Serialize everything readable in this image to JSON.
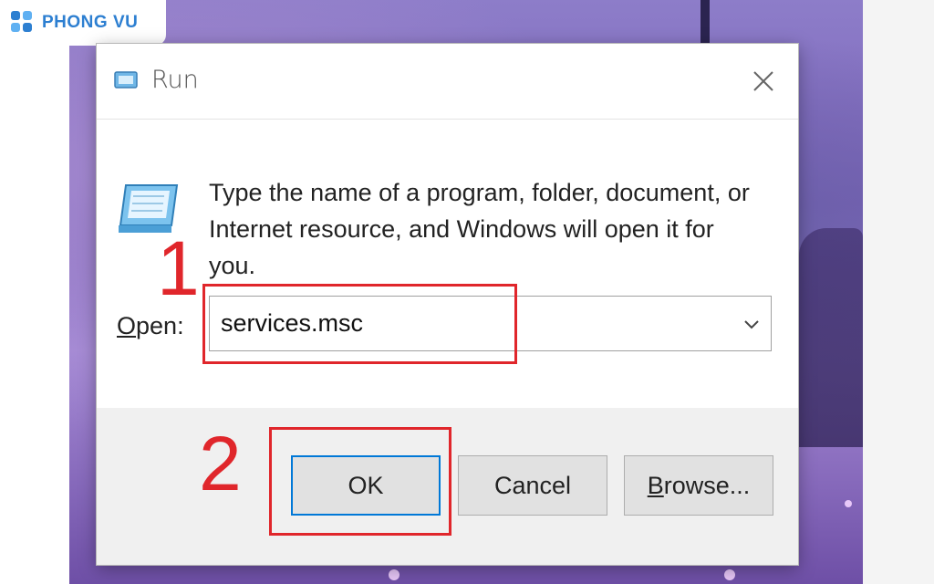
{
  "logo": {
    "text": "PHONG VU",
    "color": "#2d7fd1"
  },
  "dialog": {
    "title": "Run",
    "title_icon": "run-icon",
    "close_icon": "close-icon",
    "description": "Type the name of a program, folder, document, or Internet resource, and Windows will open it for you.",
    "open_label_accel": "O",
    "open_label_rest": "pen:",
    "open_value": "services.msc",
    "dropdown_icon": "chevron-down-icon",
    "buttons": {
      "ok": "OK",
      "cancel": "Cancel",
      "browse_accel": "B",
      "browse_rest": "rowse..."
    }
  },
  "annotations": {
    "step1": "1",
    "step2": "2",
    "color": "#e0262b"
  }
}
